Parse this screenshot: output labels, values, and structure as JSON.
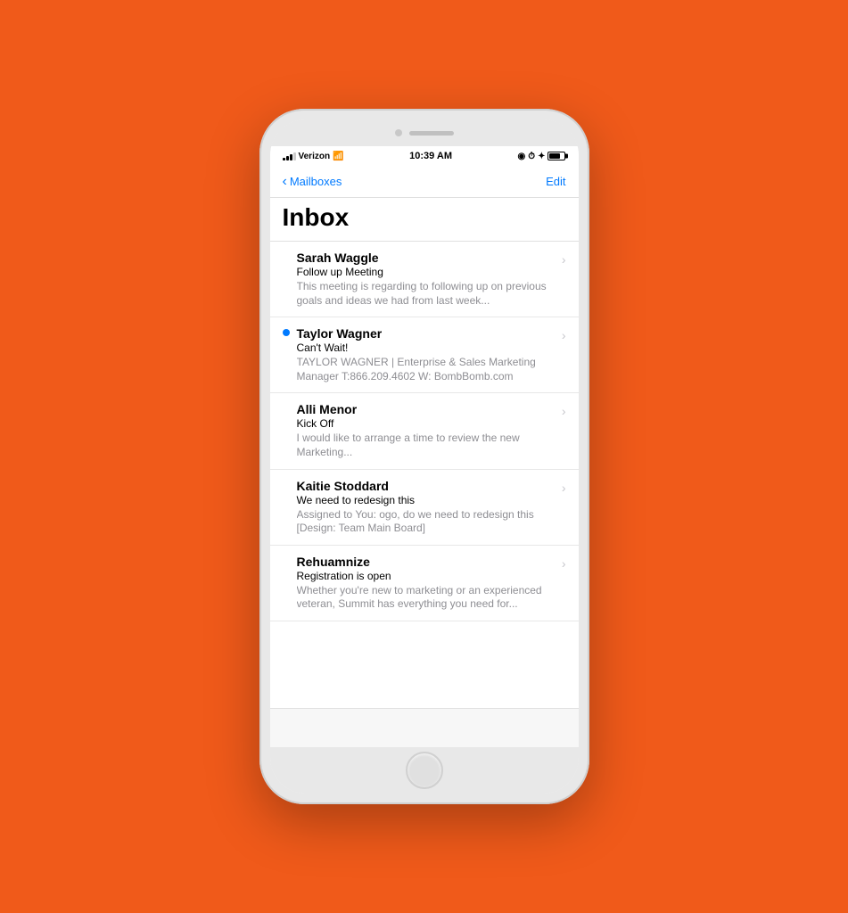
{
  "background_color": "#F05A1A",
  "status_bar": {
    "carrier": "Verizon",
    "time": "10:39 AM",
    "wifi": "wifi-icon",
    "bluetooth": "bluetooth-icon",
    "battery": "battery-icon"
  },
  "nav": {
    "back_label": "Mailboxes",
    "edit_label": "Edit"
  },
  "inbox": {
    "title": "Inbox"
  },
  "emails": [
    {
      "id": 1,
      "sender": "Sarah Waggle",
      "subject": "Follow up Meeting",
      "preview": "This meeting is regarding to following up on previous goals and ideas we had from last week...",
      "unread": false
    },
    {
      "id": 2,
      "sender": "Taylor Wagner",
      "subject": "Can't Wait!",
      "preview": "TAYLOR WAGNER | Enterprise & Sales Marketing Manager   T:866.209.4602 W: BombBomb.com",
      "unread": true
    },
    {
      "id": 3,
      "sender": "Alli Menor",
      "subject": "Kick Off",
      "preview": "I would like to arrange a time to review the new Marketing...",
      "unread": false
    },
    {
      "id": 4,
      "sender": "Kaitie Stoddard",
      "subject": "We need to redesign this",
      "preview": "Assigned to You: ogo, do we need to redesign this [Design: Team Main Board]",
      "unread": false
    },
    {
      "id": 5,
      "sender": "Rehuamnize",
      "subject": "Registration is open",
      "preview": "Whether you're new to marketing or an experienced veteran, Summit has everything you need for...",
      "unread": false
    }
  ]
}
